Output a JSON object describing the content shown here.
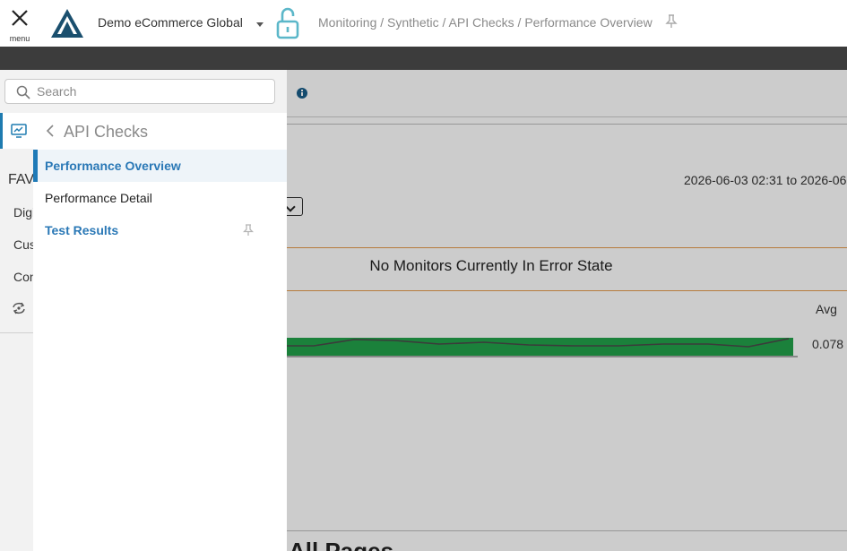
{
  "header": {
    "menu_label": "menu",
    "company": "Demo eCommerce Global",
    "breadcrumb": "Monitoring / Synthetic / API Checks / Performance Overview"
  },
  "content": {
    "date_range": "2026-06-03 02:31 to 2026-06-",
    "error_title": "No Monitors Currently In Error State",
    "avg_label": "Avg",
    "avg_value": "0.078",
    "section_title": "All Pages"
  },
  "sidebar": {
    "search_placeholder": "Search",
    "favorites_label": "FAV",
    "rail_items": [
      "Digi",
      "Cus",
      "Con"
    ],
    "submenu_title": "API Checks",
    "items": [
      {
        "label": "Performance Overview",
        "state": "active"
      },
      {
        "label": "Performance Detail",
        "state": "plain"
      },
      {
        "label": "Test Results",
        "state": "link"
      }
    ]
  },
  "colors": {
    "accent": "#2a78b6",
    "dark_bar": "#3c3c3c",
    "error_divider": "#e59a4c",
    "spark_fill": "#22a24a",
    "logo": "#1a4f6e",
    "lock": "#5bb7c9"
  },
  "icons": {
    "menu": "close-icon",
    "lock": "unlock-icon",
    "pin": "pin-icon",
    "search": "search-icon",
    "rail": "monitor-icon",
    "sync": "sync-icon",
    "back": "chevron-left-icon",
    "info": "info-icon"
  }
}
